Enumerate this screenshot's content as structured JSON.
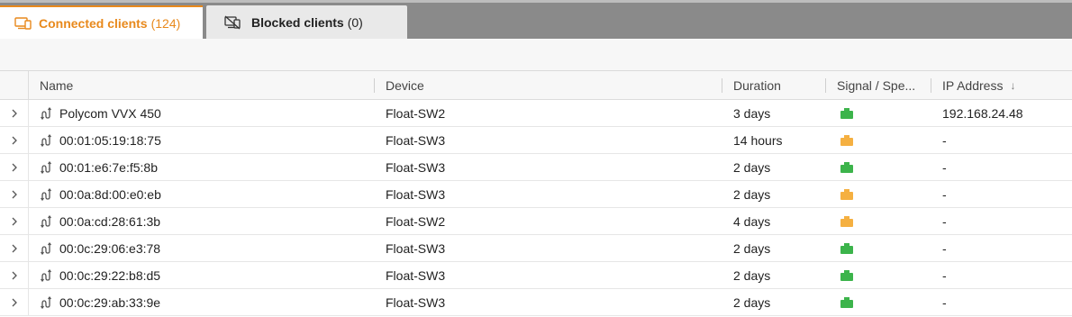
{
  "tabs": [
    {
      "label": "Connected clients",
      "count": "(124)",
      "active": true
    },
    {
      "label": "Blocked clients",
      "count": "(0)",
      "active": false
    }
  ],
  "columns": {
    "name": "Name",
    "device": "Device",
    "duration": "Duration",
    "signal": "Signal / Spe...",
    "ip": "IP Address",
    "ip_sort": "↓"
  },
  "colors": {
    "accent": "#e8891c",
    "signal_good": "#3cb44b",
    "signal_fair": "#f5b041"
  },
  "rows": [
    {
      "name": "Polycom VVX 450",
      "device": "Float-SW2",
      "duration": "3 days",
      "signal": "good",
      "ip": "192.168.24.48"
    },
    {
      "name": "00:01:05:19:18:75",
      "device": "Float-SW3",
      "duration": "14 hours",
      "signal": "fair",
      "ip": "-"
    },
    {
      "name": "00:01:e6:7e:f5:8b",
      "device": "Float-SW3",
      "duration": "2 days",
      "signal": "good",
      "ip": "-"
    },
    {
      "name": "00:0a:8d:00:e0:eb",
      "device": "Float-SW3",
      "duration": "2 days",
      "signal": "fair",
      "ip": "-"
    },
    {
      "name": "00:0a:cd:28:61:3b",
      "device": "Float-SW2",
      "duration": "4 days",
      "signal": "fair",
      "ip": "-"
    },
    {
      "name": "00:0c:29:06:e3:78",
      "device": "Float-SW3",
      "duration": "2 days",
      "signal": "good",
      "ip": "-"
    },
    {
      "name": "00:0c:29:22:b8:d5",
      "device": "Float-SW3",
      "duration": "2 days",
      "signal": "good",
      "ip": "-"
    },
    {
      "name": "00:0c:29:ab:33:9e",
      "device": "Float-SW3",
      "duration": "2 days",
      "signal": "good",
      "ip": "-"
    }
  ]
}
